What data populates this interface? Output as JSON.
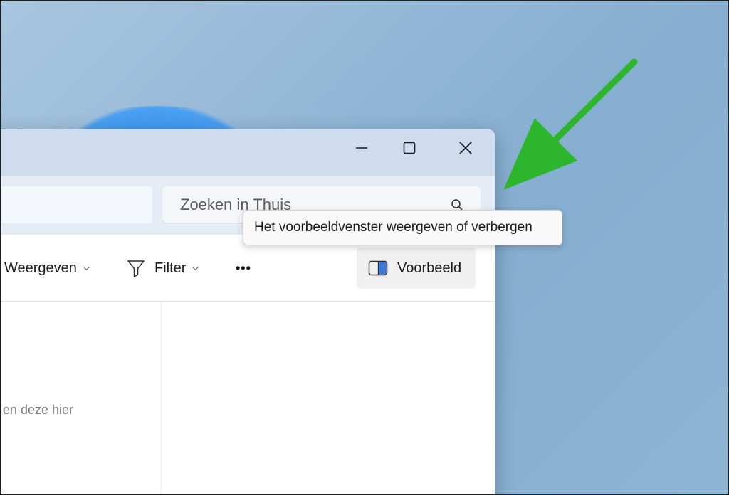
{
  "window": {
    "caption": {
      "minimize_icon": "minimize-icon",
      "maximize_icon": "maximize-icon",
      "close_icon": "close-icon"
    }
  },
  "search": {
    "placeholder": "Zoeken in Thuis",
    "icon": "search-icon"
  },
  "toolbar": {
    "view_label": "Weergeven",
    "filter_label": "Filter",
    "more_label": "•••",
    "preview_label": "Voorbeeld"
  },
  "content": {
    "empty_text": "en deze hier"
  },
  "tooltip": {
    "text": "Het voorbeeldvenster weergeven of verbergen"
  },
  "colors": {
    "arrow": "#2db52d",
    "titlebar": "#cfdcee",
    "addressbar": "#e5ecf6",
    "desktop": "#93b7d6"
  }
}
